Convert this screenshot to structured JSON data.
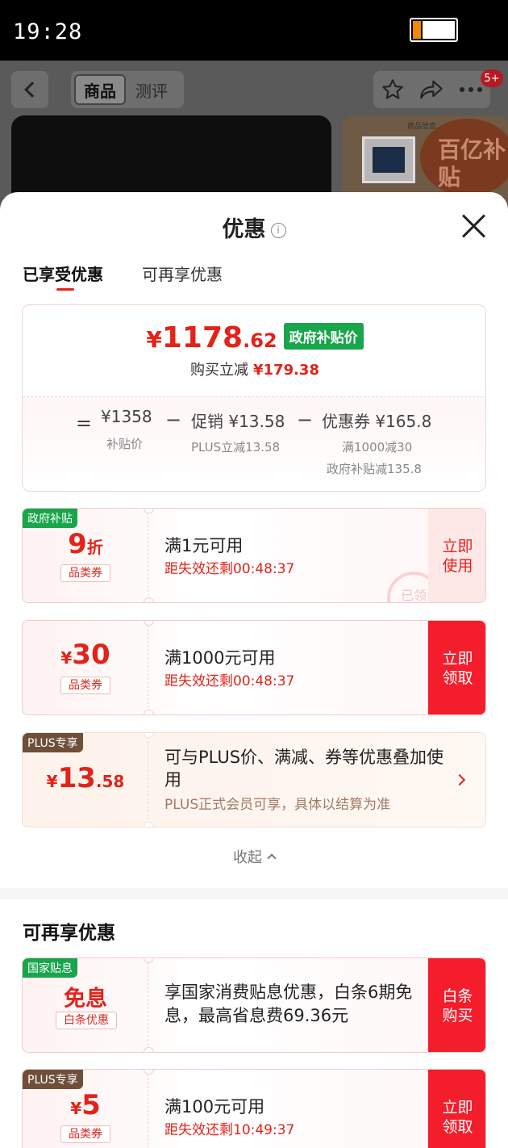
{
  "status_bar": {
    "time": "19:28"
  },
  "background": {
    "segment_tabs": [
      "商品",
      "测评"
    ],
    "badge": "5+",
    "card_caption": "商品信息",
    "promo_text": "百亿补贴"
  },
  "sheet": {
    "title": "优惠",
    "info_symbol": "i",
    "tabs": [
      "已享受优惠",
      "可再享优惠"
    ]
  },
  "summary": {
    "price_symbol": "¥",
    "price_int": "1178",
    "price_dec": ".62",
    "price_tag": "政府补贴价",
    "save_label": "购买立减",
    "save_value": "¥179.38",
    "eq": "=",
    "minus": "−",
    "base_value": "¥1358",
    "base_label": "补贴价",
    "promo_label": "促销",
    "promo_value": "¥13.58",
    "promo_sub": "PLUS立减13.58",
    "coupon_label": "优惠券",
    "coupon_value": "¥165.8",
    "coupon_sub1": "满1000减30",
    "coupon_sub2": "政府补贴减135.8"
  },
  "coupons": [
    {
      "tag": "政府补贴",
      "amount": "9",
      "unit": "折",
      "kind": "品类券",
      "title": "满1元可用",
      "countdown": "距失效还剩00:48:37",
      "button": "立即\n使用",
      "stamp": "已领"
    },
    {
      "amount_symbol": "¥",
      "amount": "30",
      "kind": "品类券",
      "title": "满1000元可用",
      "countdown": "距失效还剩00:48:37",
      "button": "立即\n领取"
    },
    {
      "tag": "PLUS专享",
      "amount_symbol": "¥",
      "amount": "13",
      "amount_dec": ".58",
      "title": "可与PLUS价、满减、券等优惠叠加使用",
      "note": "PLUS正式会员可享，具体以结算为准"
    }
  ],
  "collapse_label": "收起",
  "more_section_title": "可再享优惠",
  "more_coupons": [
    {
      "tag": "国家贴息",
      "amount": "免息",
      "kind": "白条优惠",
      "title": "享国家消费贴息优惠，白条6期免息，最高省息费69.36元",
      "button": "白条\n购买"
    },
    {
      "tag": "PLUS专享",
      "amount_symbol": "¥",
      "amount": "5",
      "kind": "品类券",
      "title": "满100元可用",
      "countdown": "距失效还剩10:49:37",
      "button": "立即\n领取"
    }
  ],
  "colors": {
    "accent_red": "#e2231a",
    "button_red": "#f31d2c",
    "gov_green": "#18a54b",
    "plus_brown": "#6e4f3a"
  }
}
